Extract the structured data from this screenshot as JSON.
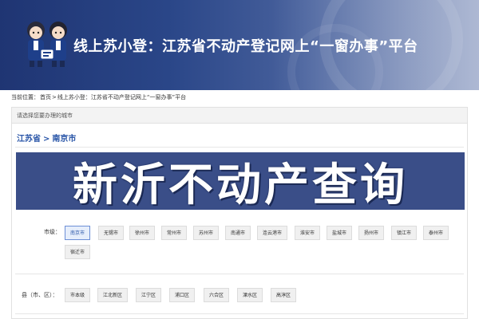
{
  "banner": {
    "title": "线上苏小登：江苏省不动产登记网上“一窗办事”平台"
  },
  "breadcrumb": {
    "prefix": "当前位置：",
    "items": [
      "首页",
      ">",
      "线上苏小登：江苏省不动产登记网上“一窗办事”平台"
    ]
  },
  "panel": {
    "header": "请选择您要办理的城市",
    "province": "江苏省",
    "separator": ">",
    "city": "南京市"
  },
  "overlay": {
    "text": "新沂不动产查询"
  },
  "cities": {
    "label": "市级：",
    "selected": "南京市",
    "items": [
      "南京市",
      "无锡市",
      "徐州市",
      "常州市",
      "苏州市",
      "南通市",
      "连云港市",
      "淮安市",
      "盐城市",
      "扬州市",
      "镇江市",
      "泰州市",
      "宿迁市"
    ]
  },
  "counties": {
    "label": "县（市、区）：",
    "items": [
      "市本级",
      "江北新区",
      "江宁区",
      "浦口区",
      "六合区",
      "溧水区",
      "高淳区"
    ]
  },
  "colors": {
    "banner": "#2a4688",
    "overlay": "#3a4e88",
    "link": "#2a56a8"
  }
}
